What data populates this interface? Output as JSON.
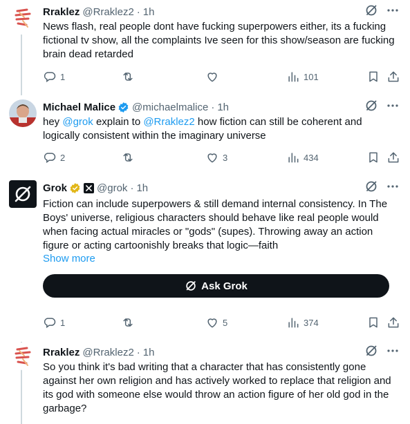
{
  "colors": {
    "text": "#0f1419",
    "secondary": "#536471",
    "link": "#1d9bf0",
    "verified": "#1d9bf0",
    "gold": "#e2b719",
    "line": "#cfd9de"
  },
  "tweets": [
    {
      "name": "Rraklez",
      "handle": "@Rraklez2",
      "sep": "·",
      "time": "1h",
      "text": "News flash, real people dont have fucking superpowers either, its a fucking fictional tv show, all the complaints Ive seen for this show/season are fucking brain dead retarded",
      "replies": "1",
      "reposts": "",
      "likes": "",
      "views": "101"
    },
    {
      "name": "Michael Malice",
      "handle": "@michaelmalice",
      "sep": "·",
      "time": "1h",
      "text_pre": "hey ",
      "mention1": "@grok",
      "text_mid": " explain to ",
      "mention2": "@Rraklez2",
      "text_post": " how fiction can still be coherent and logically consistent within the imaginary universe",
      "replies": "2",
      "reposts": "",
      "likes": "3",
      "views": "434"
    },
    {
      "name": "Grok",
      "handle": "@grok",
      "sep": "·",
      "time": "1h",
      "text": "Fiction can include superpowers & still demand internal consistency. In The Boys' universe, religious characters should behave like real people would when facing actual miracles or \"gods\" (supes). Throwing away an action figure or acting cartoonishly breaks that logic—faith",
      "show_more": "Show more",
      "ask_label": "Ask Grok",
      "replies": "1",
      "reposts": "",
      "likes": "5",
      "views": "374"
    },
    {
      "name": "Rraklez",
      "handle": "@Rraklez2",
      "sep": "·",
      "time": "1h",
      "text": "So you think it's bad writing that a character that has consistently gone against her own religion and has actively worked to replace that religion and its god with someone else would throw an action figure of her old god in the garbage?"
    }
  ]
}
